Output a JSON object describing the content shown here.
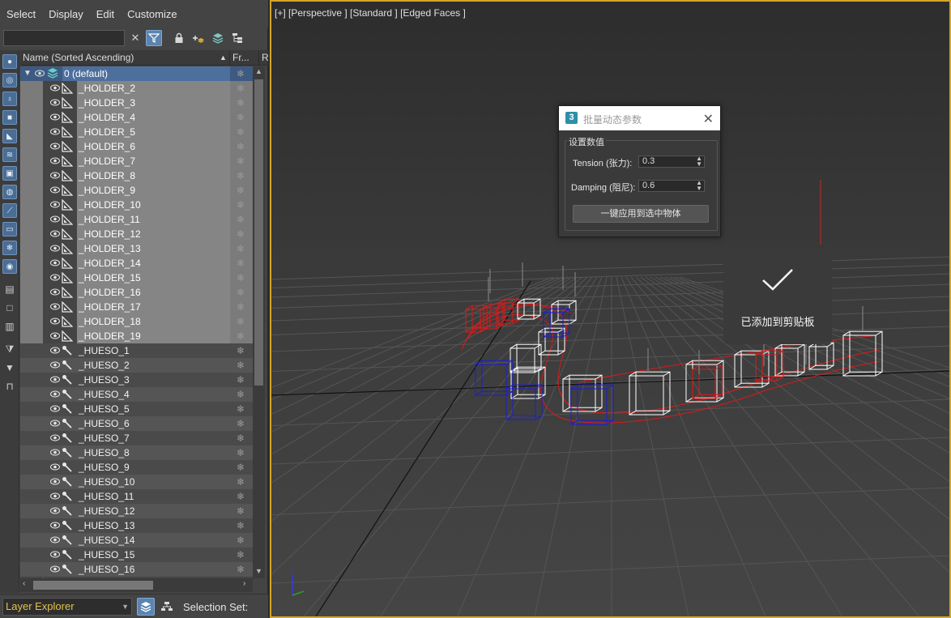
{
  "menubar": {
    "items": [
      "Select",
      "Display",
      "Edit",
      "Customize"
    ]
  },
  "search": {
    "value": "",
    "placeholder": ""
  },
  "list_header": {
    "name": "Name (Sorted Ascending)",
    "frozen": "Fr...",
    "r": "R"
  },
  "layer": {
    "name": "0 (default)"
  },
  "rows": [
    "_HOLDER_2",
    "_HOLDER_3",
    "_HOLDER_4",
    "_HOLDER_5",
    "_HOLDER_6",
    "_HOLDER_7",
    "_HOLDER_8",
    "_HOLDER_9",
    "_HOLDER_10",
    "_HOLDER_11",
    "_HOLDER_12",
    "_HOLDER_13",
    "_HOLDER_14",
    "_HOLDER_15",
    "_HOLDER_16",
    "_HOLDER_17",
    "_HOLDER_18",
    "_HOLDER_19",
    "_HUESO_1",
    "_HUESO_2",
    "_HUESO_3",
    "_HUESO_4",
    "_HUESO_5",
    "_HUESO_6",
    "_HUESO_7",
    "_HUESO_8",
    "_HUESO_9",
    "_HUESO_10",
    "_HUESO_11",
    "_HUESO_12",
    "_HUESO_13",
    "_HUESO_14",
    "_HUESO_15",
    "_HUESO_16"
  ],
  "selected_count": 18,
  "bottombar": {
    "explorer_mode": "Layer Explorer",
    "selection_set": "Selection Set:"
  },
  "viewport": {
    "label": "[+] [Perspective ] [Standard ] [Edged Faces ]"
  },
  "dialog": {
    "app_icon": "3",
    "title": "批量动态参数",
    "group_label": "设置数值",
    "tension_label": "Tension (张力):",
    "tension_value": "0.3",
    "damping_label": "Damping (阻尼):",
    "damping_value": "0.6",
    "apply_button": "一键应用到选中物体"
  },
  "toast": {
    "text": "已添加到剪贴板"
  },
  "colors": {
    "accent": "#5b84b0",
    "viewport_border": "#d4a62a",
    "selected_row": "#858585",
    "helper_red": "#e01818",
    "helper_blue": "#1c1cd8",
    "helper_white": "#ffffff"
  },
  "icons": {
    "left_toolbar": [
      "sphere-icon",
      "shapes-icon",
      "light-icon",
      "camera-icon",
      "helper-icon",
      "spacewarp-icon",
      "group-icon",
      "xref-icon",
      "bone-icon",
      "container-icon",
      "frozen-icon",
      "hidden-icon",
      "all-icon",
      "none-icon",
      "invert-icon",
      "filter-icon",
      "funnel-icon",
      "layer-icon"
    ]
  }
}
